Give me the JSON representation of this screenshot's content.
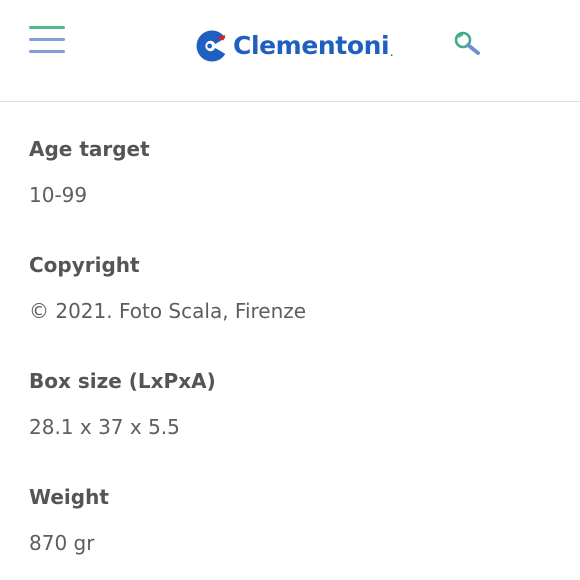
{
  "header": {
    "menu_icon": "hamburger-menu-icon",
    "brand": "Clementoni",
    "brand_suffix": ".",
    "search_icon": "magnifier-icon"
  },
  "colors": {
    "brand_blue": "#1f5fc0",
    "brand_red": "#e2221b",
    "menu_green": "#56b68c",
    "menu_blue": "#7f9fd6",
    "search_green": "#3fa98b",
    "search_blue": "#6f8fd0",
    "label_text": "#555555",
    "value_text": "#5e5e5e",
    "divider": "#dedede"
  },
  "details": [
    {
      "label": "Age target",
      "value": "10-99"
    },
    {
      "label": "Copyright",
      "value": "© 2021. Foto Scala, Firenze"
    },
    {
      "label": "Box size (LxPxA)",
      "value": "28.1 x 37 x 5.5"
    },
    {
      "label": "Weight",
      "value": "870 gr"
    }
  ]
}
